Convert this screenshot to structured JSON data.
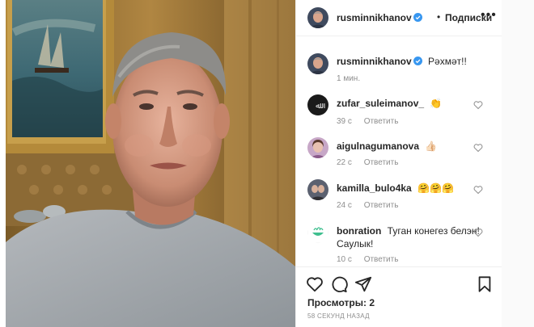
{
  "post": {
    "username": "rusminnikhanov",
    "follow_label": "Подписки",
    "dot": "•",
    "more": "•••"
  },
  "caption": {
    "username": "rusminnikhanov",
    "text": "Рәхмәт!!",
    "time": "1 мин."
  },
  "comments": [
    {
      "username": "zufar_suleimanov_",
      "text": "👏",
      "time": "39 с",
      "reply": "Ответить"
    },
    {
      "username": "aigulnagumanova",
      "text": "👍🏻",
      "time": "22 с",
      "reply": "Ответить"
    },
    {
      "username": "kamilla_bulo4ka",
      "text": "🤗🤗🤗",
      "time": "24 с",
      "reply": "Ответить"
    },
    {
      "username": "bonration",
      "text": "Туган конегез белэн! Саулык!",
      "time": "10 с",
      "reply": "Ответить"
    }
  ],
  "footer": {
    "views": "Просмотры: 2",
    "timestamp": "58 СЕКУНД НАЗАД"
  },
  "icons": {
    "like": "heart-icon",
    "comment": "comment-icon",
    "share": "send-icon",
    "save": "bookmark-icon",
    "verified": "verified-badge-icon",
    "more": "more-options-icon"
  },
  "colors": {
    "verified": "#3897f0",
    "meta": "#8e8e8e",
    "border": "#efefef"
  }
}
